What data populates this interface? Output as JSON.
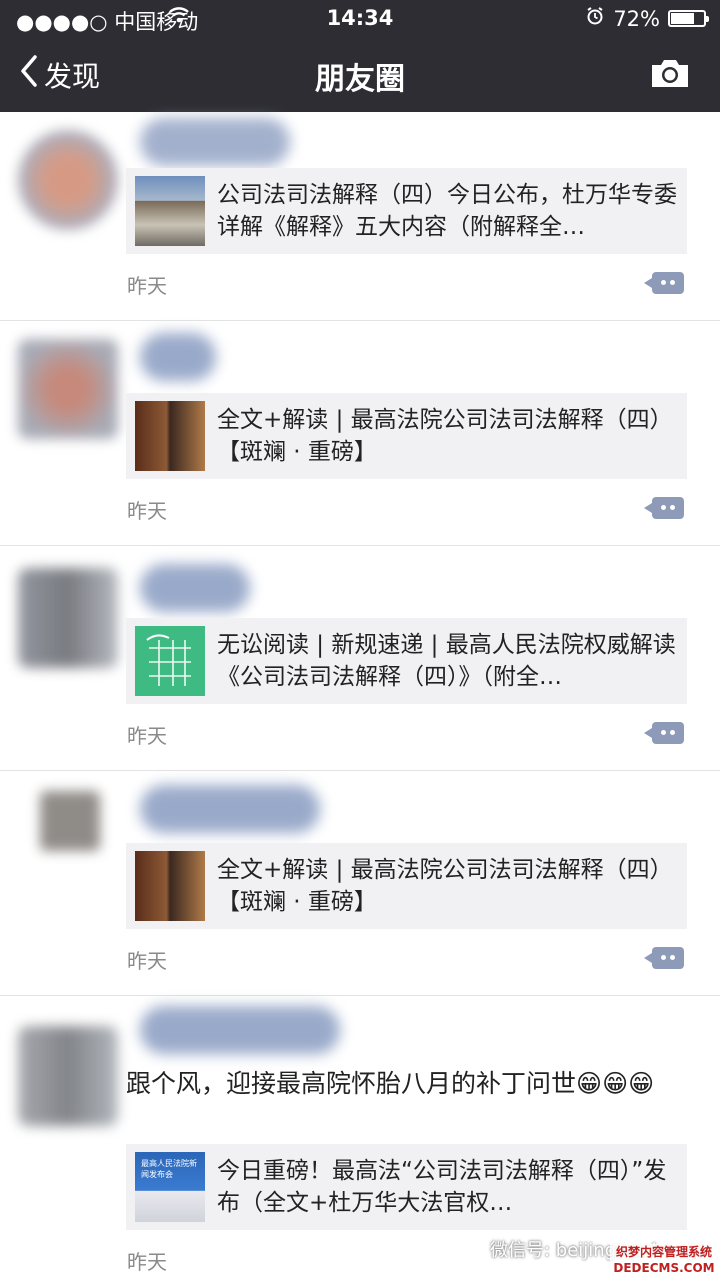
{
  "status": {
    "carrier": "●●●●○ 中国移动",
    "time": "14:34",
    "battery": "72%",
    "battery_level": 0.72
  },
  "nav": {
    "back_label": "发现",
    "title": "朋友圈"
  },
  "posts": [
    {
      "link_text": "公司法司法解释（四）今日公布，杜万华专委详解《解释》五大内容（附解释全…",
      "time": "昨天"
    },
    {
      "link_text": "全文+解读 | 最高法院公司法司法解释（四）【斑斓 · 重磅】",
      "time": "昨天"
    },
    {
      "link_text": "无讼阅读 | 新规速递 | 最高人民法院权威解读《公司法司法解释（四）》（附全…",
      "time": "昨天"
    },
    {
      "link_text": "全文+解读 | 最高法院公司法司法解释（四）【斑斓 · 重磅】",
      "time": "昨天"
    },
    {
      "text": "跟个风，迎接最高院怀胎八月的补丁问世😁😁😁",
      "link_text": "今日重磅！最高法“公司法司法解释（四）”发布（全文+杜万华大法官权…",
      "thumb_caption": "最高人民法院新闻发布会",
      "time": "昨天"
    }
  ],
  "watermark": {
    "text": "微信号: beijingwushanga",
    "site": "织梦内容管理系统 DEDECMS.COM"
  },
  "colors": {
    "header_bg": "#2e2d33",
    "link_bg": "#f1f1f3",
    "comment_icon": "#8d9ab8"
  }
}
